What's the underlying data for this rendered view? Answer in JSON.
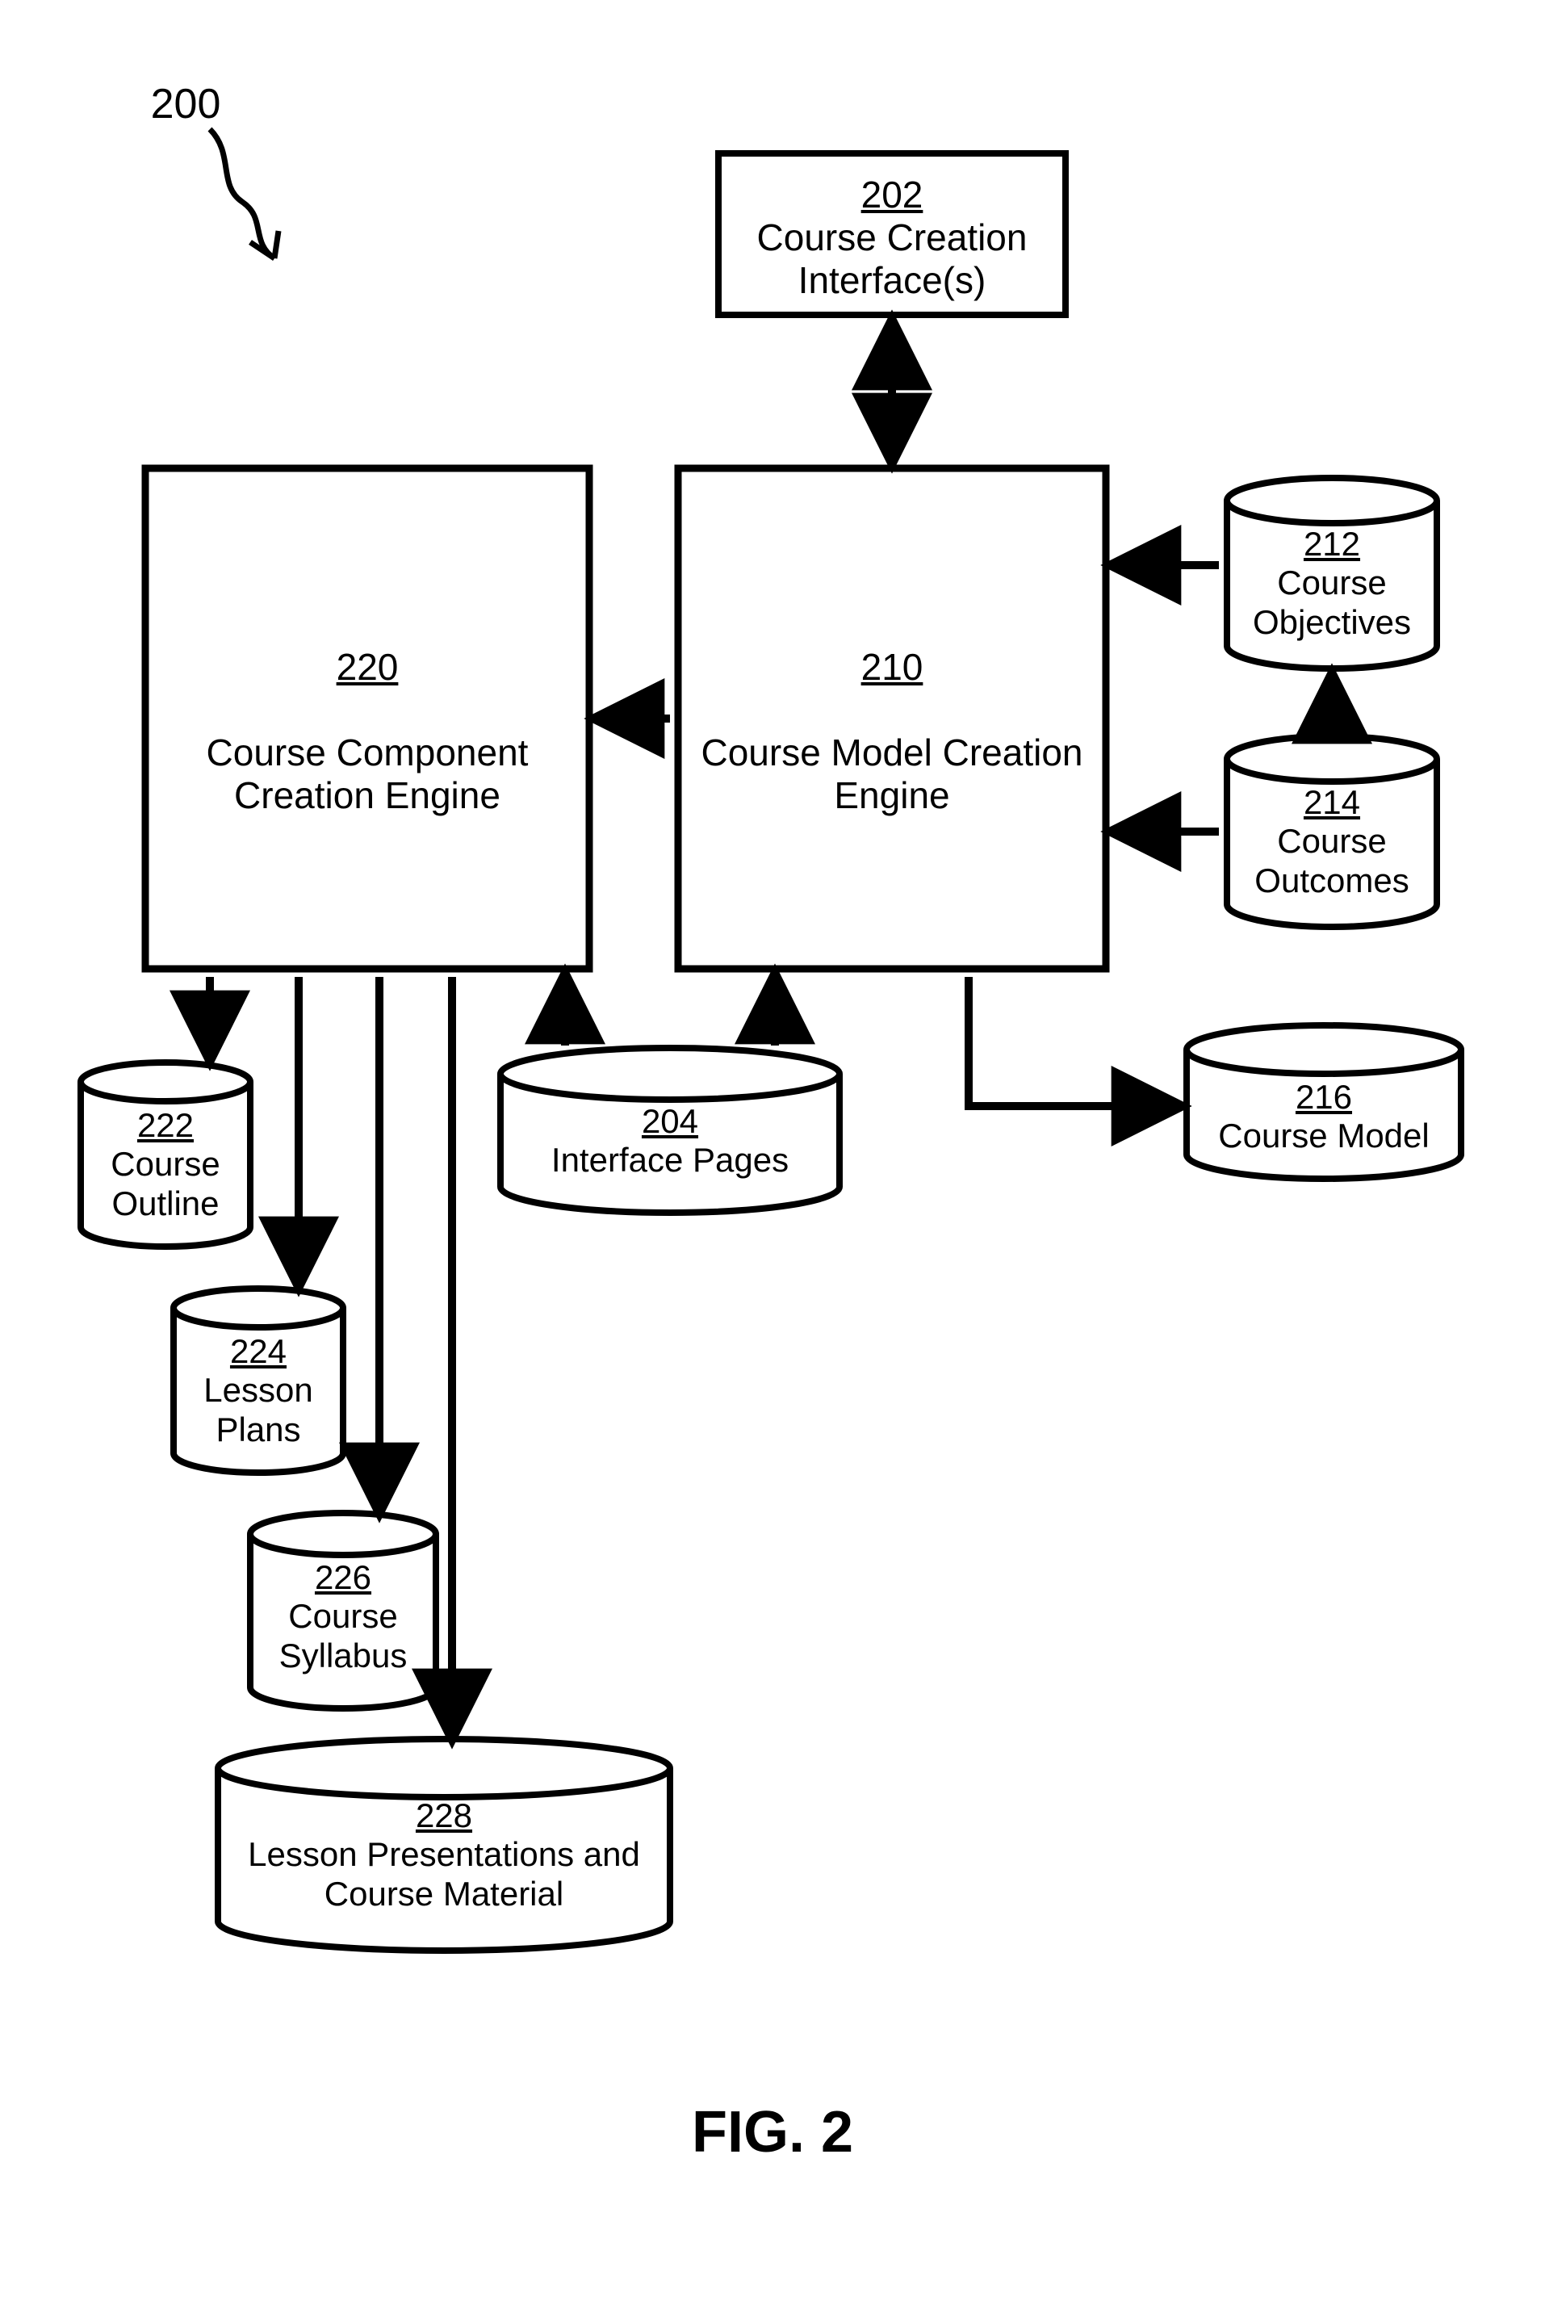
{
  "figure_ref": "200",
  "figure_label": "FIG. 2",
  "nodes": {
    "n202": {
      "ref": "202",
      "label": "Course Creation Interface(s)"
    },
    "n210": {
      "ref": "210",
      "label": "Course Model Creation Engine"
    },
    "n220": {
      "ref": "220",
      "label": "Course Component Creation Engine"
    },
    "n212": {
      "ref": "212",
      "label": "Course Objectives"
    },
    "n214": {
      "ref": "214",
      "label": "Course Outcomes"
    },
    "n216": {
      "ref": "216",
      "label": "Course Model"
    },
    "n204": {
      "ref": "204",
      "label": "Interface Pages"
    },
    "n222": {
      "ref": "222",
      "label": "Course Outline"
    },
    "n224": {
      "ref": "224",
      "label": "Lesson Plans"
    },
    "n226": {
      "ref": "226",
      "label": "Course Syllabus"
    },
    "n228": {
      "ref": "228",
      "label": "Lesson Presentations and Course Material"
    }
  },
  "edges_description": [
    "202 <-> 210 (bidirectional)",
    "210 -> 220",
    "210 -> 216",
    "212 -> 210",
    "214 -> 210",
    "214 -> 212",
    "204 -> 210",
    "204 -> 220",
    "220 -> 222",
    "220 -> 224",
    "220 -> 226",
    "220 -> 228"
  ]
}
